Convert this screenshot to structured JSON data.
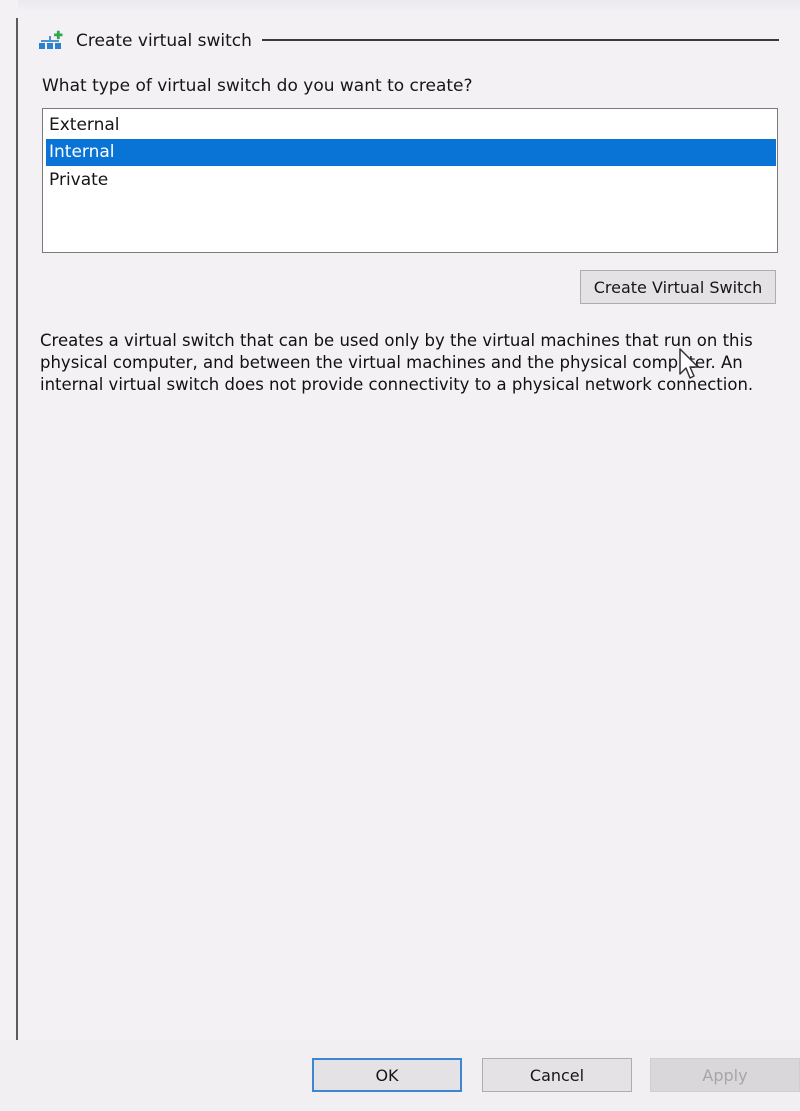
{
  "group": {
    "title": "Create virtual switch",
    "icon": "virtual-switch-icon"
  },
  "question": "What type of virtual switch do you want to create?",
  "switch_types": {
    "items": [
      "External",
      "Internal",
      "Private"
    ],
    "selected": "Internal"
  },
  "create_button_label": "Create Virtual Switch",
  "description": "Creates a virtual switch that can be used only by the virtual machines that run on this\nphysical computer, and between the virtual machines and the physical computer. An\ninternal virtual switch does not provide connectivity to a physical network connection.",
  "footer": {
    "ok_label": "OK",
    "cancel_label": "Cancel",
    "apply_label": "Apply"
  },
  "colors": {
    "selection": "#0a74d6",
    "background": "#f4f1f5",
    "disabled_text": "#a6a6a6"
  }
}
